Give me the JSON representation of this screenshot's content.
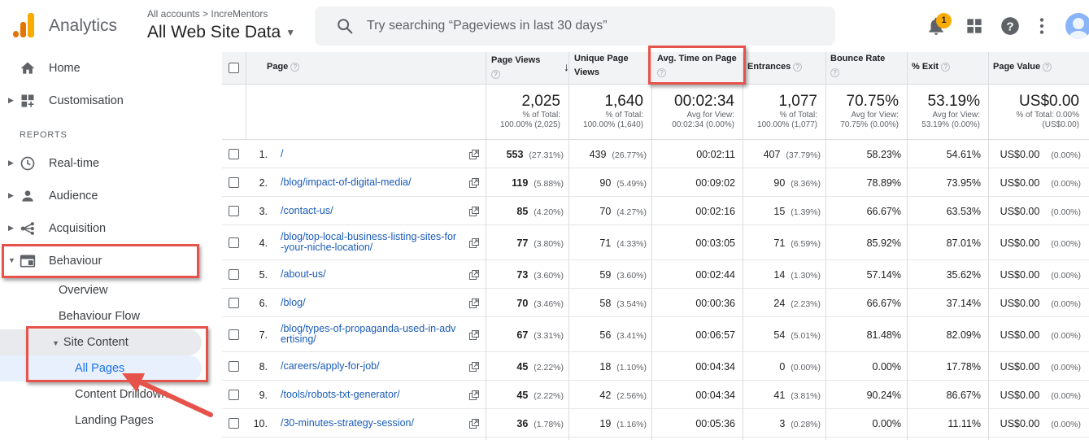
{
  "topbar": {
    "app_title": "Analytics",
    "breadcrumb": "All accounts > IncreMentors",
    "property": "All Web Site Data",
    "search_placeholder": "Try searching “Pageviews in last 30 days”",
    "notification_count": "1",
    "icons": [
      "search-icon",
      "bell-icon",
      "apps-grid-icon",
      "help-icon",
      "more-vert-icon",
      "avatar"
    ]
  },
  "sidebar": {
    "home": "Home",
    "customisation": "Customisation",
    "reports_label": "REPORTS",
    "realtime": "Real-time",
    "audience": "Audience",
    "acquisition": "Acquisition",
    "behaviour": "Behaviour",
    "overview": "Overview",
    "behaviour_flow": "Behaviour Flow",
    "site_content": "Site Content",
    "all_pages": "All Pages",
    "content_drilldown": "Content Drilldown",
    "landing_pages": "Landing Pages"
  },
  "table": {
    "headers": {
      "page": "Page",
      "page_views": "Page Views",
      "unique_line1": "Unique Page",
      "unique_line2": "Views",
      "avg_time": "Avg. Time on Page",
      "entrances": "Entrances",
      "bounce_rate": "Bounce Rate",
      "exit": "% Exit",
      "page_value": "Page Value"
    },
    "totals": {
      "page_views": {
        "big": "2,025",
        "l1": "% of Total:",
        "l2": "100.00% (2,025)"
      },
      "unique": {
        "big": "1,640",
        "l1": "% of Total:",
        "l2": "100.00% (1,640)"
      },
      "avg_time": {
        "big": "00:02:34",
        "l1": "Avg for View:",
        "l2": "00:02:34 (0.00%)"
      },
      "entrances": {
        "big": "1,077",
        "l1": "% of Total:",
        "l2": "100.00% (1,077)"
      },
      "bounce": {
        "big": "70.75%",
        "l1": "Avg for View:",
        "l2": "70.75% (0.00%)"
      },
      "exit": {
        "big": "53.19%",
        "l1": "Avg for View:",
        "l2": "53.19% (0.00%)"
      },
      "value": {
        "big": "US$0.00",
        "l1": "% of Total: 0.00%",
        "l2": "(US$0.00)"
      }
    },
    "rows": [
      {
        "idx": "1.",
        "page_l1": "/",
        "page_l2": "",
        "pv": "553",
        "pv_pct": "(27.31%)",
        "uv": "439",
        "uv_pct": "(26.77%)",
        "time": "00:02:11",
        "ent": "407",
        "ent_pct": "(37.79%)",
        "bounce": "58.23%",
        "exit": "54.61%",
        "val": "US$0.00",
        "val_pct": "(0.00%)"
      },
      {
        "idx": "2.",
        "page_l1": "/blog/impact-of-digital-media/",
        "page_l2": "",
        "pv": "119",
        "pv_pct": "(5.88%)",
        "uv": "90",
        "uv_pct": "(5.49%)",
        "time": "00:09:02",
        "ent": "90",
        "ent_pct": "(8.36%)",
        "bounce": "78.89%",
        "exit": "73.95%",
        "val": "US$0.00",
        "val_pct": "(0.00%)"
      },
      {
        "idx": "3.",
        "page_l1": "/contact-us/",
        "page_l2": "",
        "pv": "85",
        "pv_pct": "(4.20%)",
        "uv": "70",
        "uv_pct": "(4.27%)",
        "time": "00:02:16",
        "ent": "15",
        "ent_pct": "(1.39%)",
        "bounce": "66.67%",
        "exit": "63.53%",
        "val": "US$0.00",
        "val_pct": "(0.00%)"
      },
      {
        "idx": "4.",
        "page_l1": "/blog/top-local-business-listing-sites-for",
        "page_l2": "-your-niche-location/",
        "pv": "77",
        "pv_pct": "(3.80%)",
        "uv": "71",
        "uv_pct": "(4.33%)",
        "time": "00:03:05",
        "ent": "71",
        "ent_pct": "(6.59%)",
        "bounce": "85.92%",
        "exit": "87.01%",
        "val": "US$0.00",
        "val_pct": "(0.00%)"
      },
      {
        "idx": "5.",
        "page_l1": "/about-us/",
        "page_l2": "",
        "pv": "73",
        "pv_pct": "(3.60%)",
        "uv": "59",
        "uv_pct": "(3.60%)",
        "time": "00:02:44",
        "ent": "14",
        "ent_pct": "(1.30%)",
        "bounce": "57.14%",
        "exit": "35.62%",
        "val": "US$0.00",
        "val_pct": "(0.00%)"
      },
      {
        "idx": "6.",
        "page_l1": "/blog/",
        "page_l2": "",
        "pv": "70",
        "pv_pct": "(3.46%)",
        "uv": "58",
        "uv_pct": "(3.54%)",
        "time": "00:00:36",
        "ent": "24",
        "ent_pct": "(2.23%)",
        "bounce": "66.67%",
        "exit": "37.14%",
        "val": "US$0.00",
        "val_pct": "(0.00%)"
      },
      {
        "idx": "7.",
        "page_l1": "/blog/types-of-propaganda-used-in-adv",
        "page_l2": "ertising/",
        "pv": "67",
        "pv_pct": "(3.31%)",
        "uv": "56",
        "uv_pct": "(3.41%)",
        "time": "00:06:57",
        "ent": "54",
        "ent_pct": "(5.01%)",
        "bounce": "81.48%",
        "exit": "82.09%",
        "val": "US$0.00",
        "val_pct": "(0.00%)"
      },
      {
        "idx": "8.",
        "page_l1": "/careers/apply-for-job/",
        "page_l2": "",
        "pv": "45",
        "pv_pct": "(2.22%)",
        "uv": "18",
        "uv_pct": "(1.10%)",
        "time": "00:04:34",
        "ent": "0",
        "ent_pct": "(0.00%)",
        "bounce": "0.00%",
        "exit": "17.78%",
        "val": "US$0.00",
        "val_pct": "(0.00%)"
      },
      {
        "idx": "9.",
        "page_l1": "/tools/robots-txt-generator/",
        "page_l2": "",
        "pv": "45",
        "pv_pct": "(2.22%)",
        "uv": "42",
        "uv_pct": "(2.56%)",
        "time": "00:04:34",
        "ent": "41",
        "ent_pct": "(3.81%)",
        "bounce": "90.24%",
        "exit": "86.67%",
        "val": "US$0.00",
        "val_pct": "(0.00%)"
      },
      {
        "idx": "10.",
        "page_l1": "/30-minutes-strategy-session/",
        "page_l2": "",
        "pv": "36",
        "pv_pct": "(1.78%)",
        "uv": "19",
        "uv_pct": "(1.16%)",
        "time": "00:05:36",
        "ent": "3",
        "ent_pct": "(0.28%)",
        "bounce": "0.00%",
        "exit": "11.11%",
        "val": "US$0.00",
        "val_pct": "(0.00%)"
      }
    ]
  },
  "colors": {
    "highlight_box": "#e5534b",
    "link": "#1a5bb8",
    "badge": "#f9ab00"
  }
}
